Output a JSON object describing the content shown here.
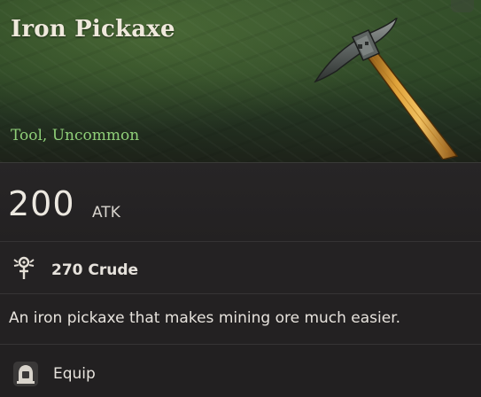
{
  "item": {
    "name": "Iron Pickaxe",
    "subtitle": "Tool, Uncommon",
    "image_icon": "iron-pickaxe-icon"
  },
  "stats": {
    "value": "200",
    "label": "ATK"
  },
  "material": {
    "icon": "crude-material-icon",
    "text": "270 Crude"
  },
  "description": "An iron pickaxe that makes mining ore much easier.",
  "action": {
    "icon": "equip-icon",
    "label": "Equip"
  },
  "colors": {
    "rarity_text": "#8fcf78",
    "header_bg": "#2f4a26",
    "panel_bg": "#222021"
  }
}
